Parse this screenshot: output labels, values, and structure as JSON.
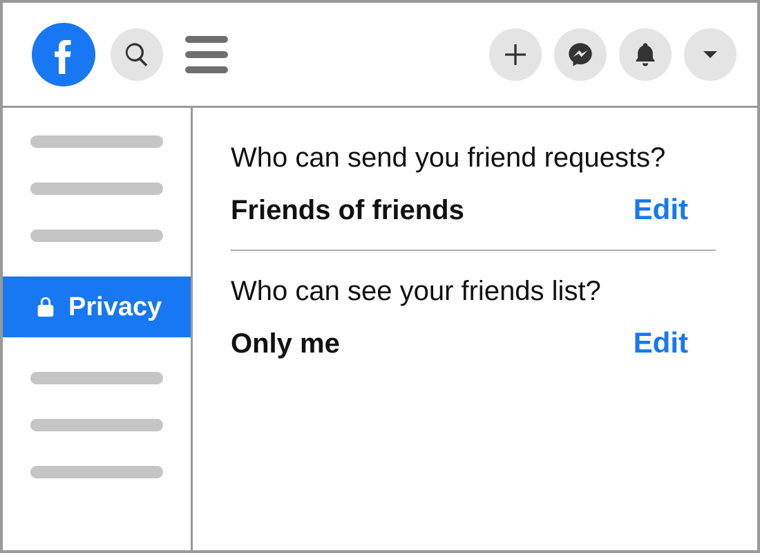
{
  "sidebar": {
    "active_label": "Privacy"
  },
  "main": {
    "settings": [
      {
        "question": "Who can send you friend requests?",
        "value": "Friends of friends",
        "edit": "Edit"
      },
      {
        "question": "Who can see your friends list?",
        "value": "Only me",
        "edit": "Edit"
      }
    ]
  },
  "colors": {
    "brand": "#1877f2",
    "link": "#1877f2"
  }
}
